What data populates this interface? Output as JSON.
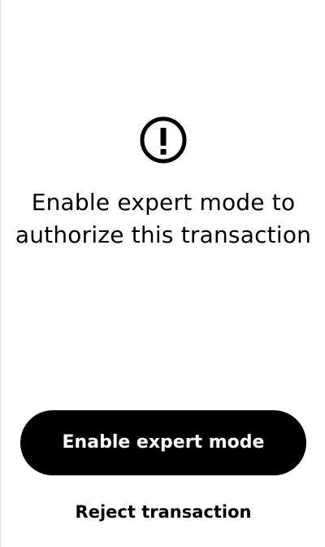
{
  "icon": {
    "name": "exclamation-circle-icon",
    "color": "#000000"
  },
  "message": "Enable expert mode to authorize this transaction",
  "actions": {
    "primary_label": "Enable expert mode",
    "secondary_label": "Reject transaction"
  },
  "colors": {
    "background": "#ffffff",
    "primary_button": "#000000",
    "primary_text": "#ffffff",
    "text": "#000000"
  }
}
